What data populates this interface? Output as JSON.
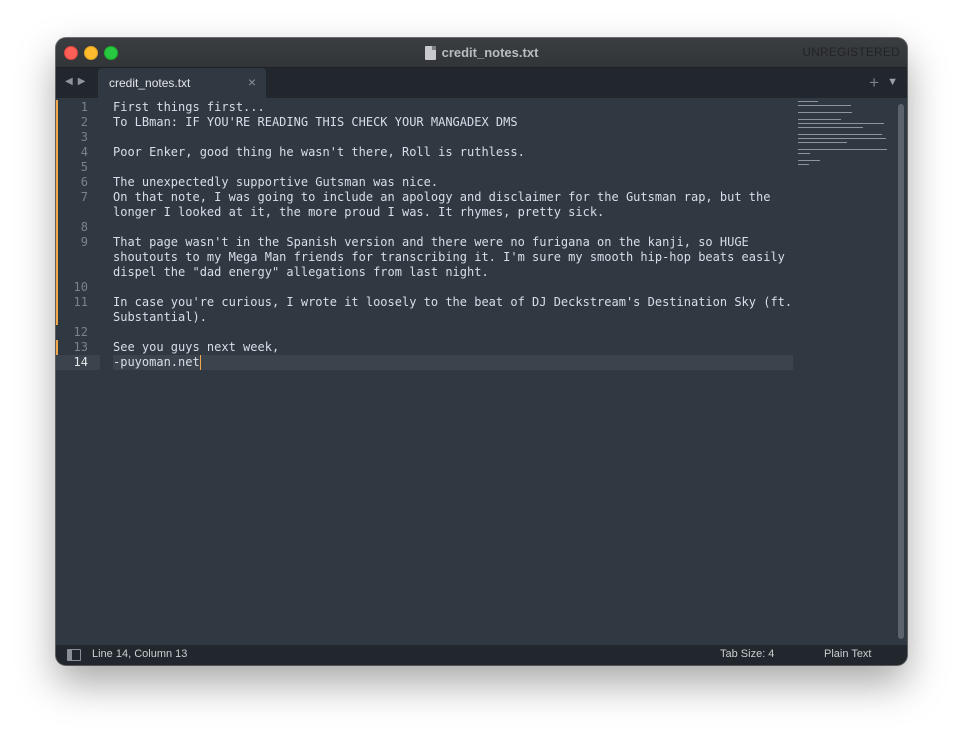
{
  "window": {
    "title": "credit_notes.txt",
    "registration": "UNREGISTERED"
  },
  "tabs": [
    {
      "label": "credit_notes.txt",
      "active": true,
      "close_glyph": "×"
    }
  ],
  "tabbar": {
    "new_tab_glyph": "+",
    "menu_glyph": "▼",
    "back_glyph": "◀",
    "forward_glyph": "▶"
  },
  "editor": {
    "line_numbers": [
      "1",
      "2",
      "3",
      "4",
      "5",
      "6",
      "7",
      "",
      "8",
      "9",
      "",
      "",
      "10",
      "11",
      "",
      "12",
      "13",
      "14"
    ],
    "modified_rows": [
      0,
      1,
      2,
      3,
      4,
      5,
      6,
      7,
      8,
      9,
      10,
      11,
      12,
      13,
      14,
      16
    ],
    "current_row": 17,
    "rows": [
      "First things first...",
      "To LBman: IF YOU'RE READING THIS CHECK YOUR MANGADEX DMS",
      "",
      "Poor Enker, good thing he wasn't there, Roll is ruthless.",
      "",
      "The unexpectedly supportive Gutsman was nice.",
      "On that note, I was going to include an apology and disclaimer for the Gutsman rap, but the",
      "longer I looked at it, the more proud I was. It rhymes, pretty sick.",
      "",
      "That page wasn't in the Spanish version and there were no furigana on the kanji, so HUGE",
      "shoutouts to my Mega Man friends for transcribing it. I'm sure my smooth hip-hop beats easily",
      "dispel the \"dad energy\" allegations from last night.",
      "",
      "In case you're curious, I wrote it loosely to the beat of DJ Deckstream's Destination Sky (ft.",
      "Substantial).",
      "",
      "See you guys next week,",
      "-puyoman.net"
    ]
  },
  "status": {
    "position": "Line 14, Column 13",
    "tab_size": "Tab Size: 4",
    "syntax": "Plain Text"
  },
  "colors": {
    "background": "#303841",
    "text": "#d8dee9",
    "modified_marker": "#f0a848",
    "caret": "#f0a848"
  }
}
